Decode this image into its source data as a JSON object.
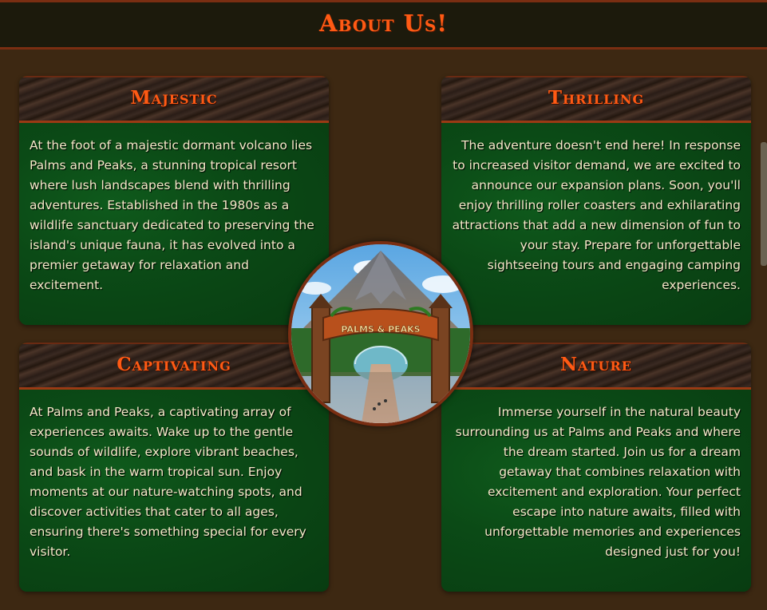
{
  "header": {
    "title": "About Us!"
  },
  "cards": {
    "majestic": {
      "title": "Majestic",
      "text": "At the foot of a majestic dormant volcano lies Palms and Peaks, a stunning tropical resort where lush landscapes blend with thrilling adventures. Established in the 1980s as a wildlife sanctuary dedicated to preserving the island's unique fauna, it has evolved into a premier getaway for relaxation and excitement."
    },
    "thrilling": {
      "title": "Thrilling",
      "text": "The adventure doesn't end here! In response to increased visitor demand, we are excited to announce our expansion plans. Soon, you'll enjoy thrilling roller coasters and exhilarating attractions that add a new dimension of fun to your stay. Prepare for unforgettable sightseeing tours and engaging camping experiences."
    },
    "captivating": {
      "title": "Captivating",
      "text": "At Palms and Peaks, a captivating array of experiences awaits. Wake up to the gentle sounds of wildlife, explore vibrant beaches, and bask in the warm tropical sun. Enjoy moments at our nature-watching spots, and discover activities that cater to all ages, ensuring there's something special for every visitor."
    },
    "nature": {
      "title": "Nature",
      "text": "Immerse yourself in the natural beauty surrounding us at Palms and Peaks and where the dream started. Join us for a dream getaway that combines relaxation with excitement and exploration. Your perfect escape into nature awaits, filled with unforgettable memories and experiences designed just for you!"
    }
  },
  "logo": {
    "sign_text": "PALMS & PEAKS"
  },
  "colors": {
    "accent": "#ff5a14",
    "background": "#3d2812",
    "card_green": "#0b4a16",
    "text_cream": "#f4e9c8"
  }
}
